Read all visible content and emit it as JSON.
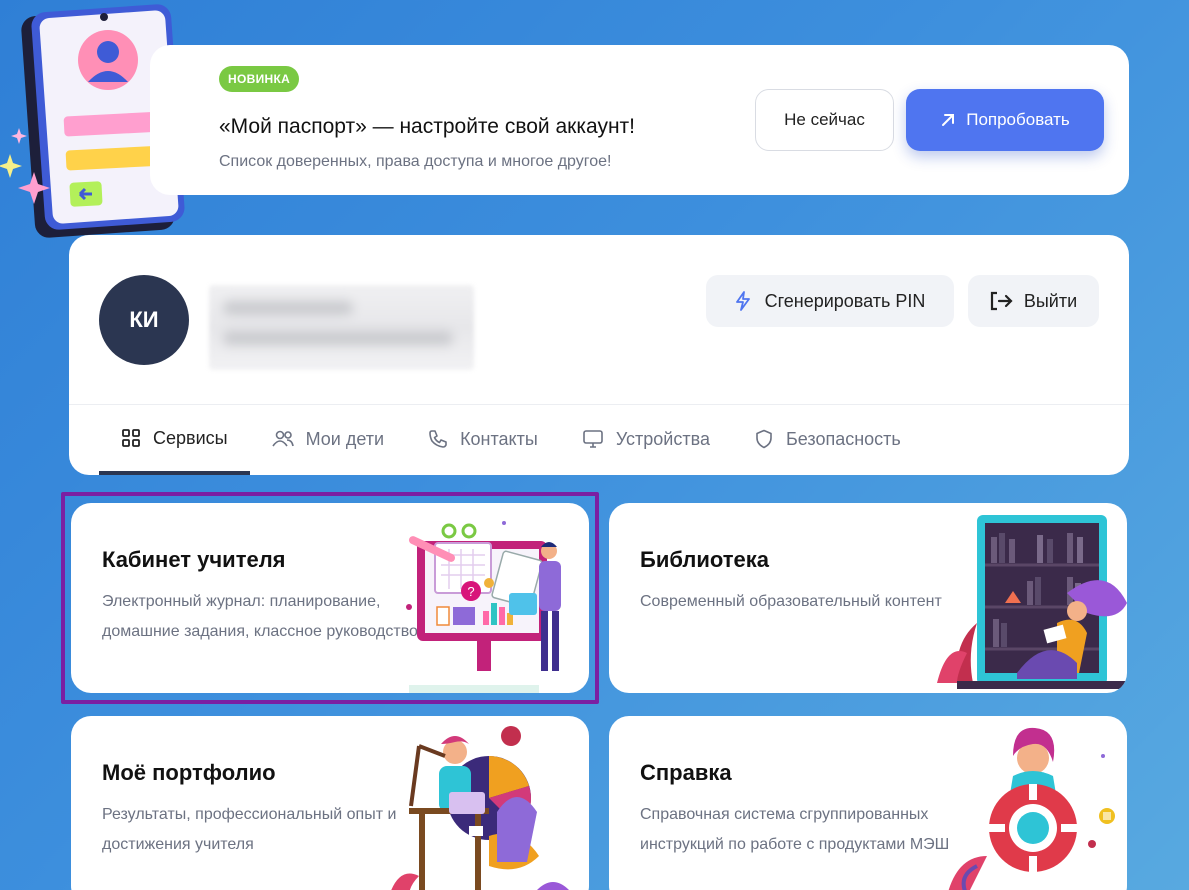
{
  "banner": {
    "badge": "НОВИНКА",
    "title": "«Мой паспорт» — настройте свой аккаунт!",
    "subtitle": "Список доверенных, права доступа и многое другое!",
    "not_now": "Не сейчас",
    "try": "Попробовать"
  },
  "profile": {
    "initials": "КИ",
    "generate_pin": "Сгенерировать PIN",
    "logout": "Выйти"
  },
  "tabs": [
    {
      "label": "Сервисы",
      "icon": "grid-icon"
    },
    {
      "label": "Мои дети",
      "icon": "users-icon"
    },
    {
      "label": "Контакты",
      "icon": "phone-icon"
    },
    {
      "label": "Устройства",
      "icon": "monitor-icon"
    },
    {
      "label": "Безопасность",
      "icon": "shield-icon"
    }
  ],
  "cards": [
    {
      "title": "Кабинет учителя",
      "description": "Электронный журнал: планирование, домашние задания, классное руководство"
    },
    {
      "title": "Библиотека",
      "description": "Современный образовательный контент"
    },
    {
      "title": "Моё портфолио",
      "description": "Результаты, профессиональный опыт и достижения учителя"
    },
    {
      "title": "Справка",
      "description": "Справочная система сгруппированных инструкций по работе с продуктами МЭШ"
    }
  ],
  "colors": {
    "accent": "#4f75f0",
    "badge": "#7ac943",
    "avatar": "#2b3651",
    "highlight": "#7b1fa2"
  }
}
